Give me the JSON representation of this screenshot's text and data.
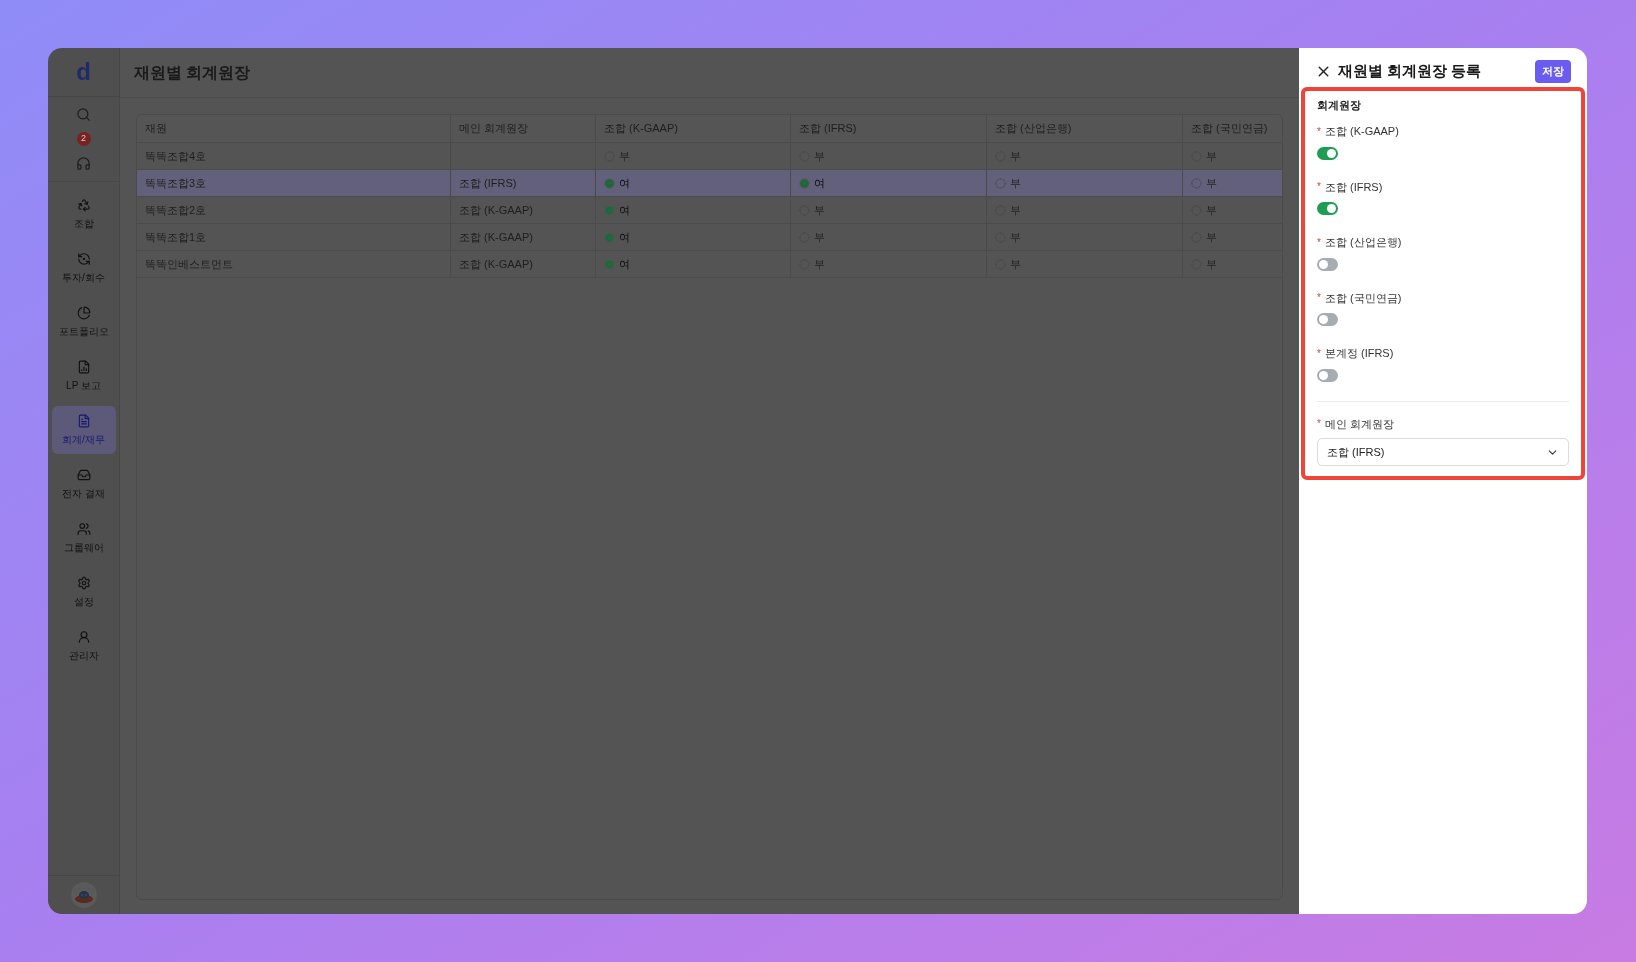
{
  "logo": "d",
  "notification_count": "2",
  "sidebar": {
    "items": [
      {
        "label": "조합",
        "selected": false
      },
      {
        "label": "투자/회수",
        "selected": false
      },
      {
        "label": "포트폴리오",
        "selected": false
      },
      {
        "label": "LP 보고",
        "selected": false
      },
      {
        "label": "회계/재무",
        "selected": true
      },
      {
        "label": "전자 결재",
        "selected": false
      },
      {
        "label": "그룹웨어",
        "selected": false
      },
      {
        "label": "설정",
        "selected": false
      },
      {
        "label": "관리자",
        "selected": false
      }
    ]
  },
  "page_title": "재원별 회계원장",
  "table": {
    "columns": [
      "재원",
      "메인 회계원장",
      "조합 (K-GAAP)",
      "조합 (IFRS)",
      "조합 (산업은행)",
      "조합 (국민연금)"
    ],
    "rows": [
      {
        "fund": "똑똑조합4호",
        "main_ledger": "",
        "selected": false,
        "flags": [
          {
            "text": "부",
            "checked": false
          },
          {
            "text": "부",
            "checked": false
          },
          {
            "text": "부",
            "checked": false
          },
          {
            "text": "부",
            "checked": false
          }
        ]
      },
      {
        "fund": "똑똑조합3호",
        "main_ledger": "조합 (IFRS)",
        "selected": true,
        "flags": [
          {
            "text": "여",
            "checked": true
          },
          {
            "text": "여",
            "checked": true
          },
          {
            "text": "부",
            "checked": false
          },
          {
            "text": "부",
            "checked": false
          }
        ]
      },
      {
        "fund": "똑똑조합2호",
        "main_ledger": "조합 (K-GAAP)",
        "selected": false,
        "flags": [
          {
            "text": "여",
            "checked": true
          },
          {
            "text": "부",
            "checked": false
          },
          {
            "text": "부",
            "checked": false
          },
          {
            "text": "부",
            "checked": false
          }
        ]
      },
      {
        "fund": "똑똑조합1호",
        "main_ledger": "조합 (K-GAAP)",
        "selected": false,
        "flags": [
          {
            "text": "여",
            "checked": true
          },
          {
            "text": "부",
            "checked": false
          },
          {
            "text": "부",
            "checked": false
          },
          {
            "text": "부",
            "checked": false
          }
        ]
      },
      {
        "fund": "똑똑인베스트먼트",
        "main_ledger": "조합 (K-GAAP)",
        "selected": false,
        "flags": [
          {
            "text": "여",
            "checked": true
          },
          {
            "text": "부",
            "checked": false
          },
          {
            "text": "부",
            "checked": false
          },
          {
            "text": "부",
            "checked": false
          }
        ]
      }
    ]
  },
  "drawer": {
    "title": "재원별 회계원장 등록",
    "save_button": "저장",
    "section_title": "회계원장",
    "toggles": [
      {
        "required_mark": "*",
        "label": "조합 (K-GAAP)",
        "on": true
      },
      {
        "required_mark": "*",
        "label": "조합 (IFRS)",
        "on": true
      },
      {
        "required_mark": "*",
        "label": "조합 (산업은행)",
        "on": false
      },
      {
        "required_mark": "*",
        "label": "조합 (국민연금)",
        "on": false
      },
      {
        "required_mark": "*",
        "label": "본계정 (IFRS)",
        "on": false
      }
    ],
    "main_ledger": {
      "required_mark": "*",
      "label": "메인 회계원장",
      "value": "조합 (IFRS)"
    }
  }
}
